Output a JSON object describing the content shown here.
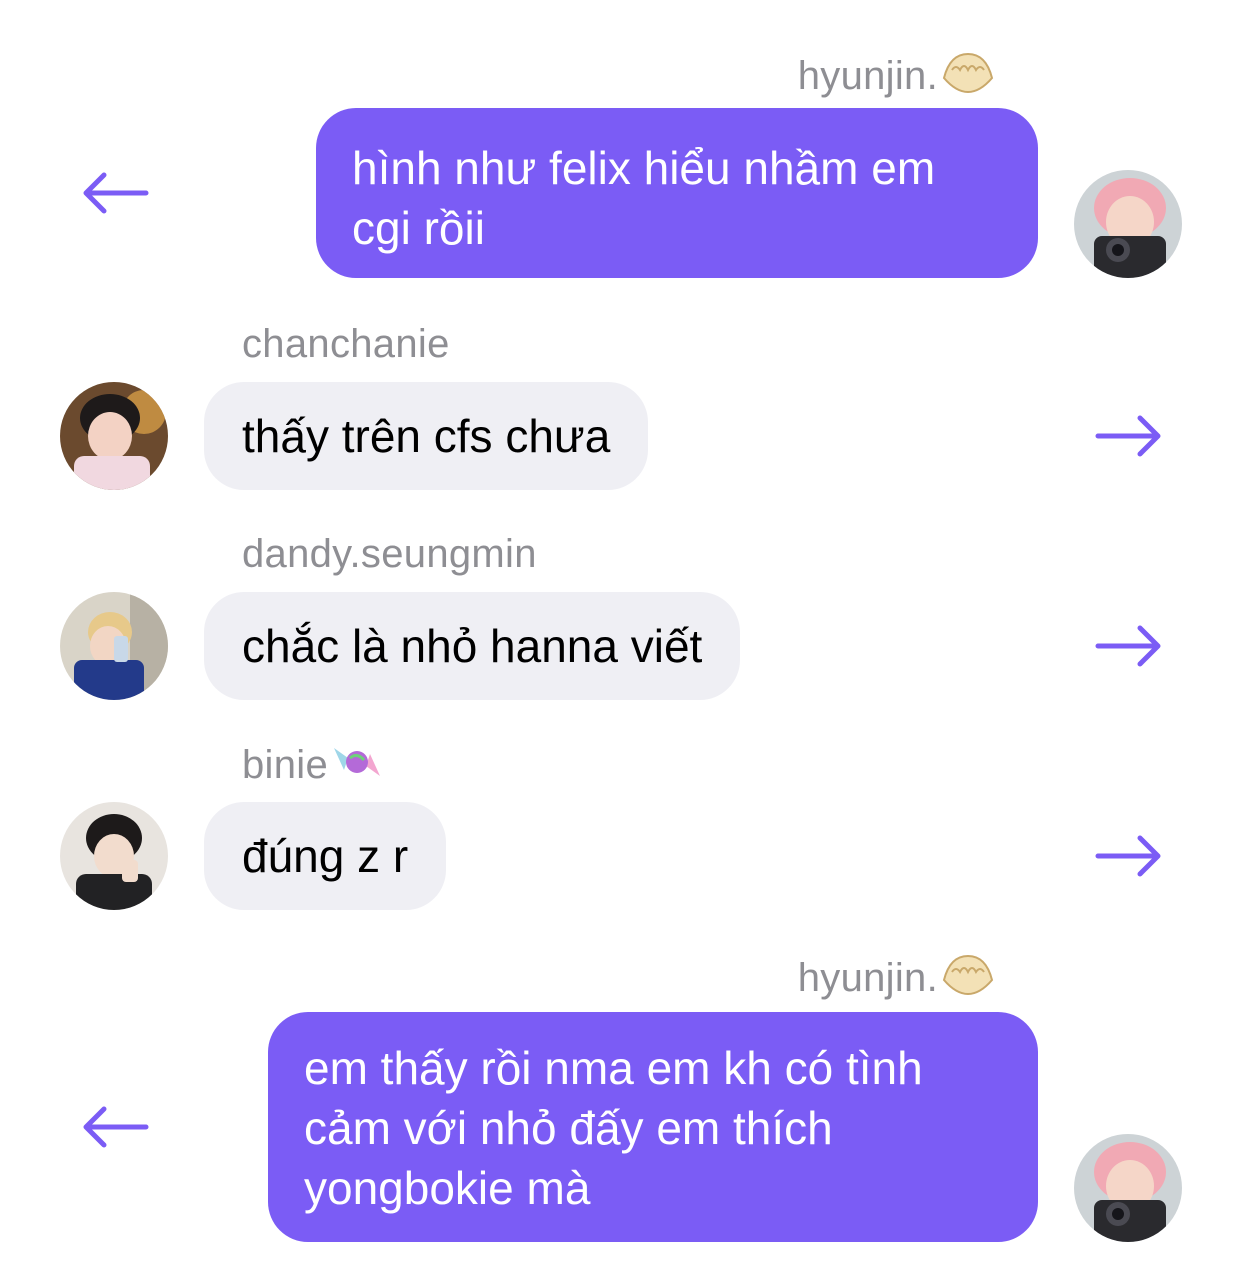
{
  "messages": [
    {
      "direction": "outgoing",
      "sender": "hyunjin.",
      "sender_emoji": "dumpling-emoji",
      "lines": [
        "hình như felix hiểu nhầm em",
        "cgi rồii"
      ],
      "action_icon": "reply-left-arrow-icon"
    },
    {
      "direction": "incoming",
      "sender": "chanchanie",
      "lines": [
        "thấy trên cfs chưa"
      ],
      "action_icon": "forward-right-arrow-icon"
    },
    {
      "direction": "incoming",
      "sender": "dandy.seungmin",
      "lines": [
        "chắc là nhỏ hanna viết"
      ],
      "action_icon": "forward-right-arrow-icon"
    },
    {
      "direction": "incoming",
      "sender": "binie",
      "sender_emoji": "candy-emoji",
      "lines": [
        "đúng z r"
      ],
      "action_icon": "forward-right-arrow-icon"
    },
    {
      "direction": "outgoing",
      "sender": "hyunjin.",
      "sender_emoji": "dumpling-emoji",
      "lines": [
        "em thấy rồi nma em kh có tình",
        "cảm với nhỏ đấy em thích",
        "yongbokie mà"
      ],
      "action_icon": "reply-left-arrow-icon"
    }
  ],
  "colors": {
    "outgoing_bubble": "#7b5cf5",
    "incoming_bubble": "#efeff4",
    "sender_label": "#8e8e93",
    "arrow": "#7b5cf5"
  }
}
